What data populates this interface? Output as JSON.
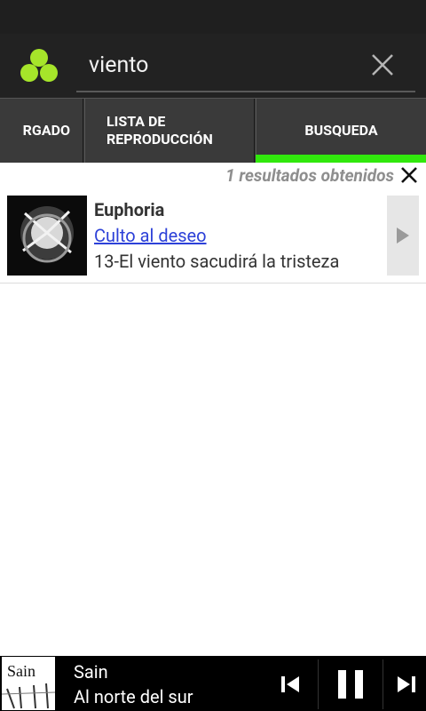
{
  "search": {
    "query": "viento"
  },
  "tabs": {
    "downloaded": "RGADO",
    "playlist_line1": "LISTA DE",
    "playlist_line2": "REPRODUCCIÓN",
    "search": "BUSQUEDA"
  },
  "results": {
    "summary": "1 resultados obtenidos",
    "items": [
      {
        "artist": "Euphoria",
        "album": "Culto al deseo",
        "track": "13-El viento sacudirá la tristeza"
      }
    ]
  },
  "player": {
    "artist": "Sain",
    "album": "Al norte del sur",
    "cover_text": "Sain"
  },
  "colors": {
    "accent": "#31e80d",
    "link": "#2d41d8",
    "logo": "#a6e52a"
  },
  "icons": [
    "app-logo-icon",
    "clear-icon",
    "close-icon",
    "play-arrow-icon",
    "previous-icon",
    "pause-icon",
    "next-icon"
  ]
}
